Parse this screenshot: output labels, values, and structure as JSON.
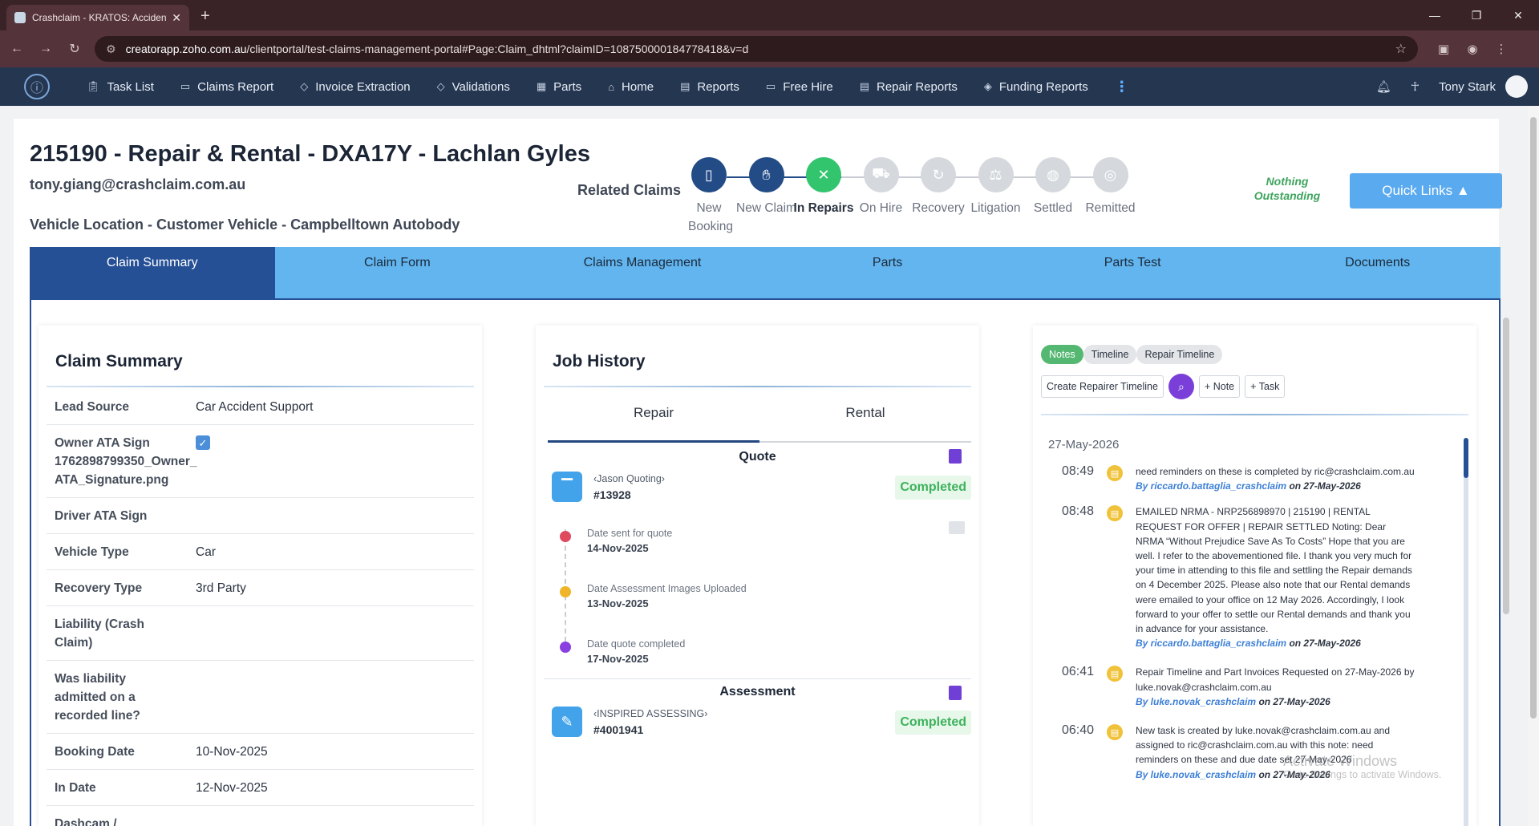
{
  "browser": {
    "tab_title": "Crashclaim - KRATOS: Accident",
    "url_host": "creatorapp.zoho.com.au",
    "url_path": "/clientportal/test-claims-management-portal#Page:Claim_dhtml?claimID=108750000184778418&v=d"
  },
  "nav": {
    "items": [
      {
        "label": "Task List",
        "icon": "clipboard-icon"
      },
      {
        "label": "Claims Report",
        "icon": "monitor-icon"
      },
      {
        "label": "Invoice Extraction",
        "icon": "tag-icon"
      },
      {
        "label": "Validations",
        "icon": "tag-icon"
      },
      {
        "label": "Parts",
        "icon": "box-icon"
      },
      {
        "label": "Home",
        "icon": "home-icon"
      },
      {
        "label": "Reports",
        "icon": "report-icon"
      },
      {
        "label": "Free Hire",
        "icon": "monitor-icon"
      },
      {
        "label": "Repair Reports",
        "icon": "report-icon"
      },
      {
        "label": "Funding Reports",
        "icon": "funding-icon"
      }
    ],
    "user": "Tony Stark"
  },
  "claim": {
    "title": "215190 - Repair & Rental - DXA17Y - Lachlan Gyles",
    "email": "tony.giang@crashclaim.com.au",
    "vehicle_location": "Vehicle Location - Customer Vehicle - Campbelltown Autobody",
    "related_claims": "Related Claims",
    "nothing_outstanding": "Nothing Outstanding",
    "quick_links": "Quick Links ▲"
  },
  "stages": [
    {
      "label": "New Booking",
      "state": "done",
      "icon": "phone-icon"
    },
    {
      "label": "New Claim",
      "state": "done",
      "icon": "hand-icon"
    },
    {
      "label": "In Repairs",
      "state": "active",
      "icon": "tools-icon"
    },
    {
      "label": "On Hire",
      "state": "pending",
      "icon": "car-icon"
    },
    {
      "label": "Recovery",
      "state": "pending",
      "icon": "refresh-icon"
    },
    {
      "label": "Litigation",
      "state": "pending",
      "icon": "gavel-icon"
    },
    {
      "label": "Settled",
      "state": "pending",
      "icon": "handshake-icon"
    },
    {
      "label": "Remitted",
      "state": "pending",
      "icon": "money-icon"
    }
  ],
  "tabs": [
    "Claim Summary",
    "Claim Form",
    "Claims Management",
    "Parts",
    "Parts Test",
    "Documents"
  ],
  "summary": {
    "title": "Claim Summary",
    "rows": [
      {
        "k": "Lead Source",
        "v": "Car Accident Support"
      },
      {
        "k": "Owner ATA Sign\n1762898799350_Owner_\nATA_Signature.png",
        "v": "",
        "checkbox": true
      },
      {
        "k": "Driver ATA Sign",
        "v": ""
      },
      {
        "k": "Vehicle Type",
        "v": "Car"
      },
      {
        "k": "Recovery Type",
        "v": "3rd Party"
      },
      {
        "k": "Liability (Crash Claim)",
        "v": ""
      },
      {
        "k": "Was liability admitted on a recorded line?",
        "v": ""
      },
      {
        "k": "Booking Date",
        "v": "10-Nov-2025"
      },
      {
        "k": "In Date",
        "v": "12-Nov-2025"
      },
      {
        "k": "Dashcam /",
        "v": ""
      }
    ]
  },
  "job_history": {
    "title": "Job History",
    "tabs": [
      "Repair",
      "Rental"
    ],
    "quote": {
      "head": "Quote",
      "company": "‹Jason Quoting›",
      "number": "#13928",
      "status": "Completed",
      "events": [
        {
          "t": "Date sent for quote",
          "d": "14-Nov-2025",
          "c": "#e04a5f"
        },
        {
          "t": "Date Assessment Images Uploaded",
          "d": "13-Nov-2025",
          "c": "#f0b429"
        },
        {
          "t": "Date quote completed",
          "d": "17-Nov-2025",
          "c": "#8a3fe0"
        }
      ]
    },
    "assessment": {
      "head": "Assessment",
      "company": "‹INSPIRED ASSESSING›",
      "number": "#4001941",
      "status": "Completed"
    }
  },
  "notes": {
    "pills": [
      "Notes",
      "Timeline",
      "Repair Timeline"
    ],
    "buttons": [
      "Create Repairer Timeline",
      "+ Note",
      "+ Task"
    ],
    "date": "27-May-2026",
    "items": [
      {
        "time": "08:49",
        "text": "need reminders on these is completed by ric@crashclaim.com.au",
        "by": "By riccardo.battaglia_crashclaim",
        "on": "on 27-May-2026"
      },
      {
        "time": "08:48",
        "text": "EMAILED NRMA - NRP256898970 | 215190 | RENTAL REQUEST FOR OFFER | REPAIR SETTLED Noting: Dear NRMA “Without Prejudice Save As To Costs” Hope that you are well. I refer to the abovementioned file. I thank you very much for your time in attending to this file and settling the Repair demands on 4 December 2025. Please also note that our Rental demands were emailed to your office on 12 May 2026. Accordingly, I look forward to your offer to settle our Rental demands and thank you in advance for your assistance.",
        "by": "By riccardo.battaglia_crashclaim",
        "on": "on 27-May-2026"
      },
      {
        "time": "06:41",
        "text": "Repair Timeline and Part Invoices Requested on 27-May-2026 by luke.novak@crashclaim.com.au",
        "by": "By luke.novak_crashclaim",
        "on": "on 27-May-2026"
      },
      {
        "time": "06:40",
        "text": "New task is created by luke.novak@crashclaim.com.au and assigned to ric@crashclaim.com.au with this note: need reminders on these and due date set 27-May-2026",
        "by": "By luke.novak_crashclaim",
        "on": "on 27-May-2026"
      }
    ]
  },
  "watermark": {
    "line1": "Activate Windows",
    "line2": "Go to Settings to activate Windows."
  }
}
